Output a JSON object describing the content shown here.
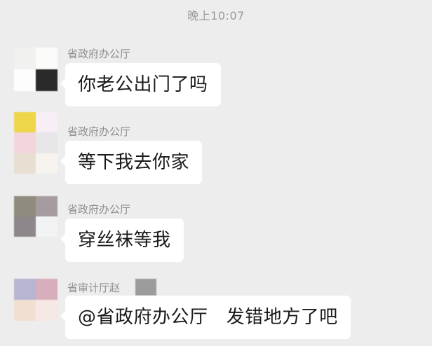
{
  "timestamp": "晚上10:07",
  "messages": [
    {
      "sender": "省政府办公厅",
      "text": "你老公出门了吗",
      "avatar_colors": [
        "#f1f1f0",
        "#fbfbfa",
        "#fdfdfd",
        "#2a2a2a"
      ]
    },
    {
      "sender": "省政府办公厅",
      "text": "等下我去你家",
      "avatar_colors": [
        "#eed54a",
        "#f7eef6",
        "#f3d6dc",
        "#e7e7e9",
        "#e6dfd2",
        "#f7f4f0"
      ]
    },
    {
      "sender": "省政府办公厅",
      "text": "穿丝袜等我",
      "avatar_colors": [
        "#8f8b7e",
        "#a69b9f",
        "#8d868a",
        "#f2f3f4"
      ]
    },
    {
      "sender": "省审计厅赵",
      "text": "@省政府办公厅   发错地方了吧",
      "avatar_colors": [
        "#b8b5d2",
        "#d7aebb",
        "#f1e0d2",
        "#f5e7e4"
      ],
      "has_badge": true
    }
  ]
}
